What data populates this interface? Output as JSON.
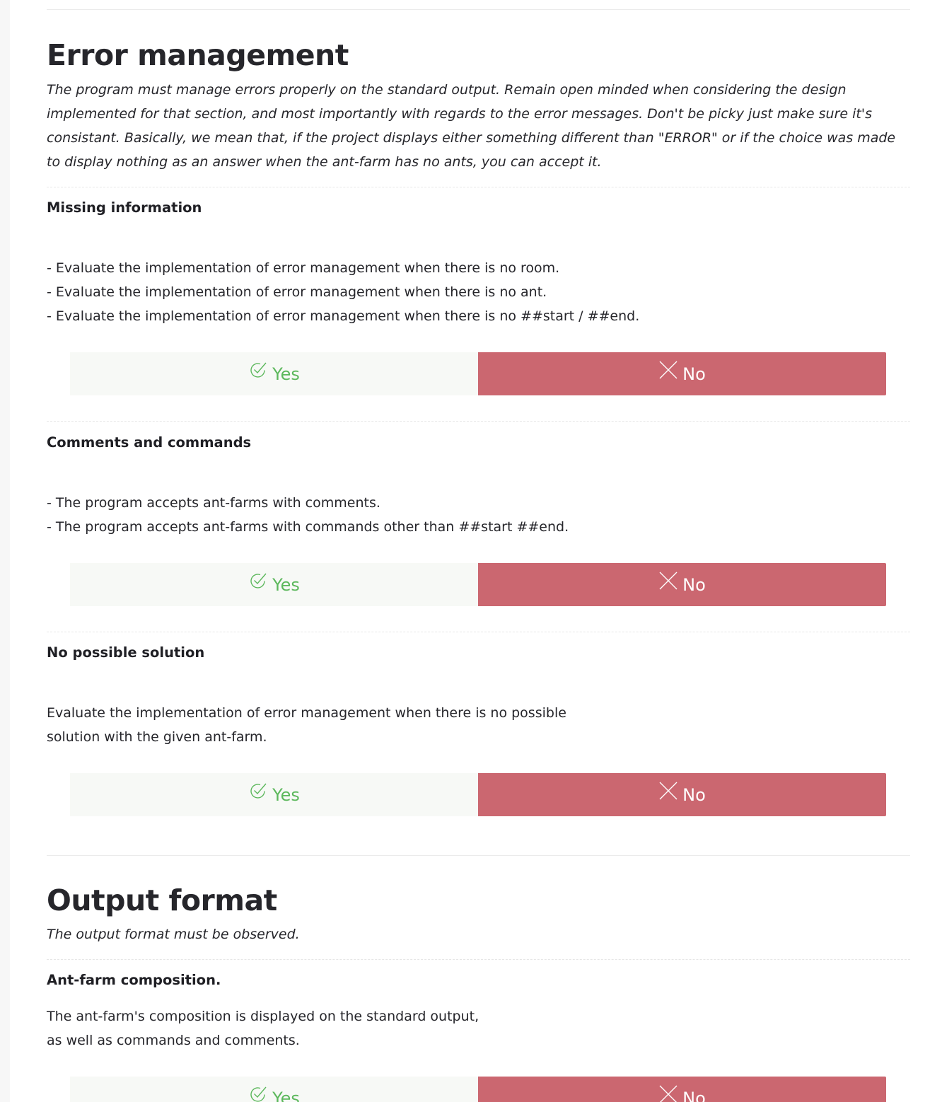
{
  "sections": [
    {
      "title": "Error management",
      "description": "The program must manage errors properly on the standard output. Remain open minded when considering the design implemented for that section, and most importantly with regards to the error messages. Don't be picky just make sure it's consistant. Basically, we mean that, if the project displays either something different than \"ERROR\" or if the choice was made to display nothing as an answer when the ant-farm has no ants, you can accept it.",
      "questions": [
        {
          "title": "Missing information",
          "lines": [
            "- Evaluate the implementation of error management when there is no room.",
            "- Evaluate the implementation of error management when there is no ant.",
            "- Evaluate the implementation of error management when there is no ##start / ##end."
          ],
          "yes_label": "Yes",
          "no_label": "No"
        },
        {
          "title": "Comments and commands",
          "lines": [
            "- The program accepts ant-farms with comments.",
            "- The program accepts ant-farms with commands other than ##start ##end."
          ],
          "yes_label": "Yes",
          "no_label": "No"
        },
        {
          "title": "No possible solution",
          "lines": [
            "Evaluate the implementation of error management when there is no possible",
            "solution with the given ant-farm."
          ],
          "yes_label": "Yes",
          "no_label": "No"
        }
      ]
    },
    {
      "title": "Output format",
      "description": "The output format must be observed.",
      "questions": [
        {
          "title": "Ant-farm composition.",
          "lines": [
            "The ant-farm's composition is displayed on the standard output,",
            "as well as commands and comments."
          ],
          "yes_label": "Yes",
          "no_label": "No"
        }
      ]
    }
  ],
  "colors": {
    "yes_text": "#5cb85c",
    "yes_bg": "#f7f9f6",
    "no_bg": "#cb6770",
    "title_text": "#26262b"
  },
  "icons": {
    "yes": "check-circle-icon",
    "no": "close-icon"
  }
}
